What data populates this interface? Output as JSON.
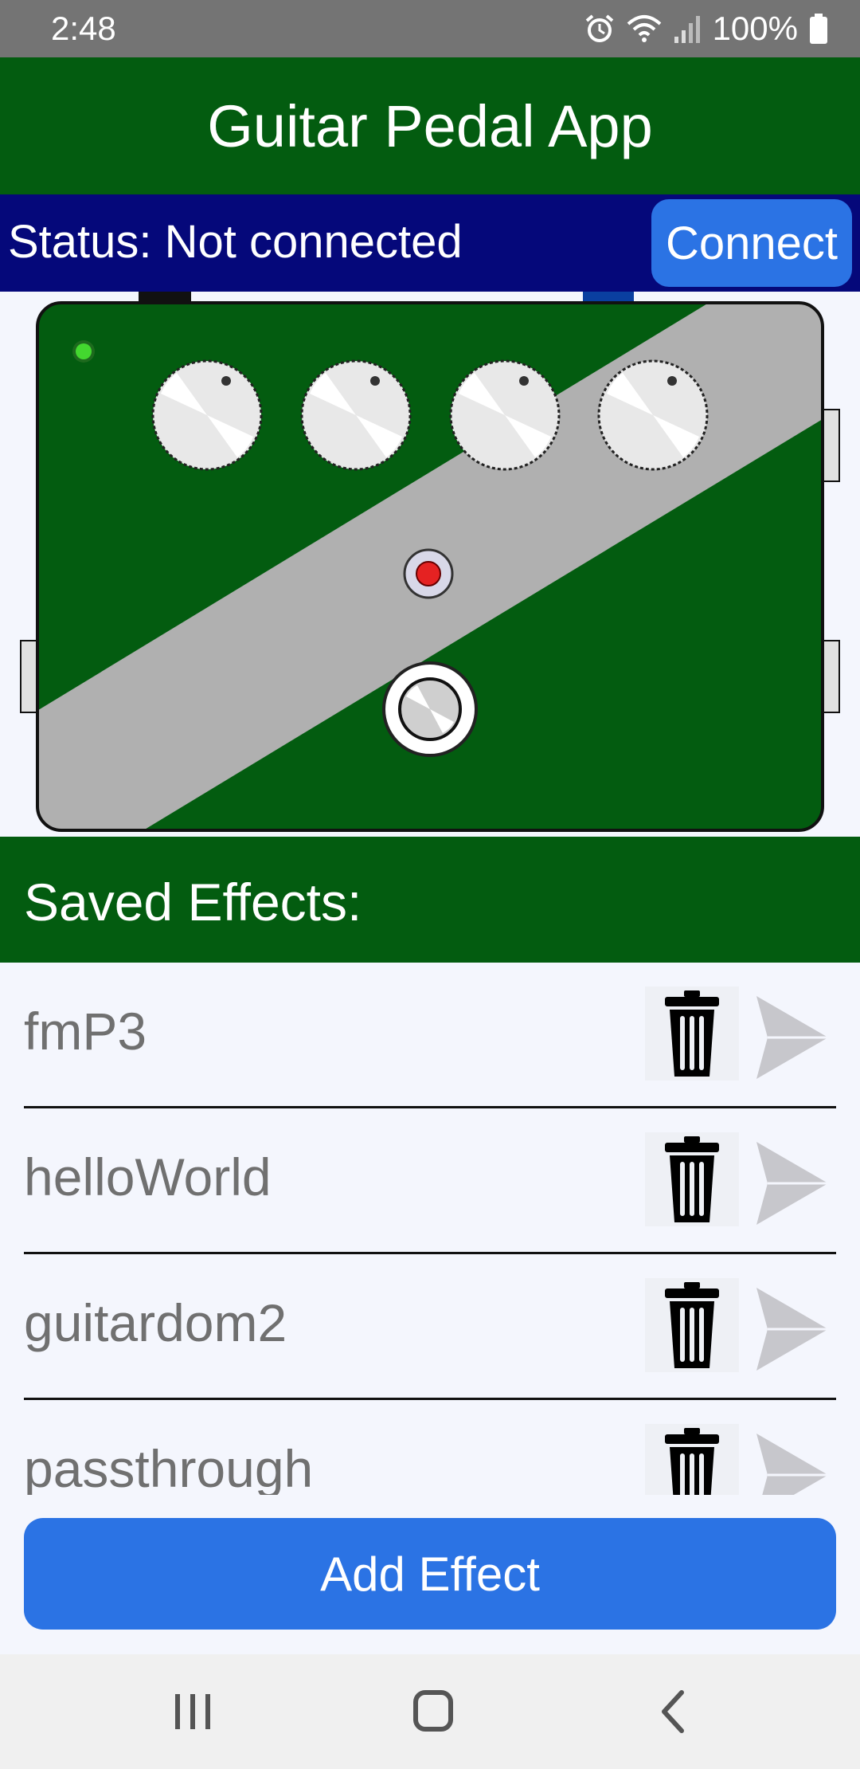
{
  "status_bar": {
    "time": "2:48",
    "battery": "100%",
    "icons": [
      "alarm-icon",
      "wifi-icon",
      "signal-icon",
      "battery-icon"
    ]
  },
  "app_bar": {
    "title": "Guitar Pedal App"
  },
  "connection": {
    "status_text": "Status: Not connected",
    "connect_label": "Connect"
  },
  "pedal": {
    "knob_count": 4,
    "led_color": "#43d82f",
    "body_color": "#035c10",
    "stripe_color": "#b0b0b0"
  },
  "saved_effects": {
    "header": "Saved Effects:",
    "items": [
      {
        "name": "fmP3"
      },
      {
        "name": "helloWorld"
      },
      {
        "name": "guitardom2"
      },
      {
        "name": "passthrough"
      }
    ]
  },
  "add_effect_label": "Add Effect",
  "colors": {
    "header_green": "#035c10",
    "status_navy": "#05087a",
    "accent_blue": "#2b73e4"
  }
}
